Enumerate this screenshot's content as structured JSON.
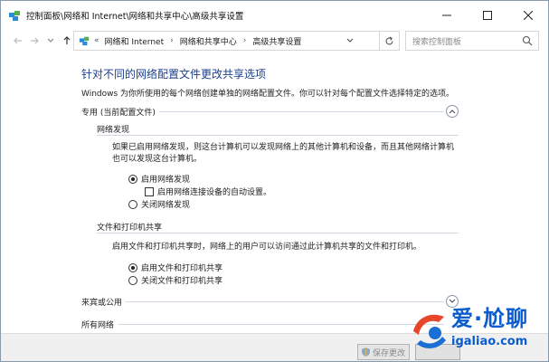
{
  "window": {
    "title": "控制面板\\网络和 Internet\\网络和共享中心\\高级共享设置"
  },
  "address": {
    "prefix": "«",
    "crumbs": [
      "网络和 Internet",
      "网络和共享中心",
      "高级共享设置"
    ],
    "separator": "›"
  },
  "search": {
    "placeholder": "搜索控制面板"
  },
  "page": {
    "heading": "针对不同的网络配置文件更改共享选项",
    "subtitle": "Windows 为你所使用的每个网络创建单独的网络配置文件。你可以针对每个配置文件选择特定的选项。"
  },
  "sections": {
    "private": {
      "label": "专用 (当前配置文件)",
      "network_discovery": {
        "label": "网络发现",
        "description": "如果已启用网络发现，则这台计算机可以发现网络上的其他计算机和设备，而且其他网络计算机也可以发现这台计算机。",
        "option_on": "启用网络发现",
        "option_auto": "启用网络连接设备的自动设置。",
        "option_off": "关闭网络发现",
        "selected": "on",
        "auto_checked": false
      },
      "file_printer_sharing": {
        "label": "文件和打印机共享",
        "description": "启用文件和打印机共享时，网络上的用户可以访问通过此计算机共享的文件和打印机。",
        "option_on": "启用文件和打印机共享",
        "option_off": "关闭文件和打印机共享",
        "selected": "on"
      }
    },
    "guest_public": {
      "label": "来宾或公用"
    },
    "all_networks": {
      "label": "所有网络"
    }
  },
  "footer": {
    "save_label": "保存更改"
  },
  "watermark": {
    "brand": "爱·尬聊",
    "url": "igaliao.com"
  },
  "colors": {
    "heading": "#1b3f8f",
    "accent": "#0a5ccf",
    "watermark_red": "#d9281e"
  }
}
